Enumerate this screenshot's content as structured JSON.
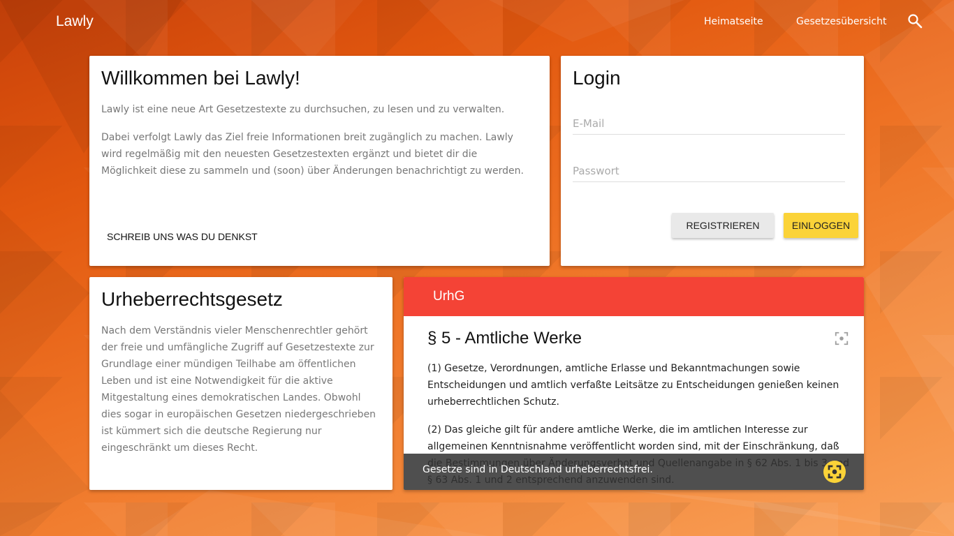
{
  "nav": {
    "brand": "Lawly",
    "links": [
      "Heimatseite",
      "Gesetzesübersicht"
    ],
    "search_icon": "search-icon"
  },
  "welcome": {
    "title": "Willkommen bei Lawly!",
    "paragraphs": [
      "Lawly ist eine neue Art Gesetzestexte zu durchsuchen, zu lesen und zu verwalten.",
      "Dabei verfolgt Lawly das Ziel freie Informationen breit zugänglich zu machen. Lawly wird regelmäßig mit den neuesten Gesetzestexten ergänzt und bietet dir die Möglichkeit diese zu sammeln und (soon) über Änderungen benachrichtigt zu werden."
    ],
    "feedback_label": "SCHREIB UNS WAS DU DENKST"
  },
  "login": {
    "title": "Login",
    "email_placeholder": "E-Mail",
    "password_placeholder": "Passwort",
    "register_label": "REGISTRIEREN",
    "login_label": "EINLOGGEN"
  },
  "copyright": {
    "title": "Urheberrechtsgesetz",
    "text": "Nach dem Verständnis vieler Menschenrechtler gehört der freie und umfängliche Zugriff auf Gesetzestexte zur Grundlage einer mündigen Teilhabe am öffentlichen Leben und ist eine Notwendigkeit für die aktive Mitgestaltung eines demokratischen Landes. Obwohl dies sogar in europäischen Gesetzen niedergeschrieben ist kümmert sich die deutsche Regierung nur eingeschränkt um dieses Recht."
  },
  "law": {
    "header": "UrhG",
    "section_title": "§ 5 - Amtliche Werke",
    "paragraphs": [
      "(1) Gesetze, Verordnungen, amtliche Erlasse und Bekanntmachungen sowie Entscheidungen und amtlich verfaßte Leitsätze zu Entscheidungen genießen keinen urheberrechtlichen Schutz.",
      "(2) Das gleiche gilt für andere amtliche Werke, die im amtlichen Interesse zur allgemeinen Kenntnisnahme veröffentlicht worden sind, mit der Einschränkung, daß die Bestimmungen über Änderungsverbot und Quellenangabe in § 62 Abs. 1 bis 3 und § 63 Abs. 1 und 2 entsprechend anzuwenden sind."
    ],
    "focus_icon": "center-focus-icon",
    "snackbar_text": "Gesetze sind in Deutschland urheberrechtsfrei.",
    "snackbar_icon": "center-focus-icon"
  },
  "colors": {
    "accent": "#fbd338",
    "law_header": "#f44336",
    "background": "#e2580f"
  }
}
